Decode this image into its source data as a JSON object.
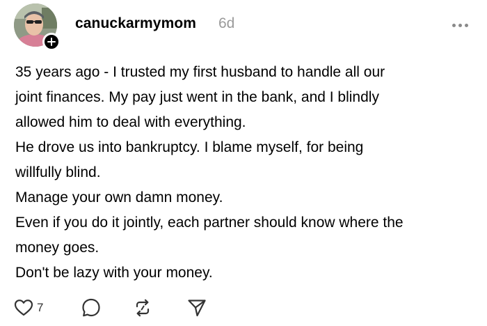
{
  "post": {
    "author": {
      "username": "canuckarmymom",
      "avatar_icon": "user-avatar",
      "follow_icon": "plus-icon"
    },
    "time_ago": "6d",
    "more_icon": "more-horizontal-icon",
    "paragraphs": [
      {
        "lines": [
          "35 years ago - I trusted my first husband to handle all our",
          "joint finances.  My pay just went in the bank, and I blindly",
          "allowed him to deal with everything."
        ]
      },
      {
        "lines": [
          "He drove us into bankruptcy.  I blame myself, for being",
          "willfully blind."
        ]
      },
      {
        "lines": [
          "Manage your own damn money."
        ]
      },
      {
        "lines": [
          "Even if you do it jointly, each partner should know where the",
          "money goes."
        ]
      },
      {
        "lines": [
          "Don't be lazy with your money."
        ]
      }
    ],
    "actions": {
      "like": {
        "icon": "heart-icon",
        "count": "7"
      },
      "reply": {
        "icon": "comment-icon"
      },
      "repost": {
        "icon": "repost-icon"
      },
      "share": {
        "icon": "send-icon"
      }
    }
  }
}
